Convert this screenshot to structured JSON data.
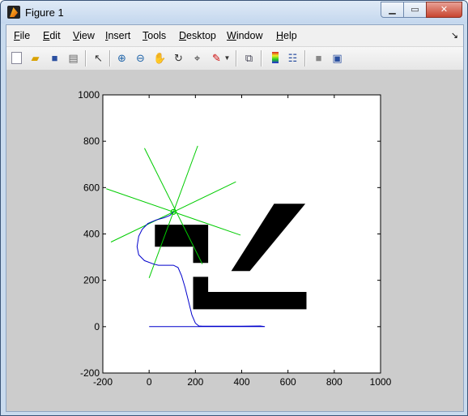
{
  "window": {
    "title": "Figure 1"
  },
  "menu": {
    "items": [
      {
        "key": "F",
        "rest": "ile"
      },
      {
        "key": "E",
        "rest": "dit"
      },
      {
        "key": "V",
        "rest": "iew"
      },
      {
        "key": "I",
        "rest": "nsert"
      },
      {
        "key": "T",
        "rest": "ools"
      },
      {
        "key": "D",
        "rest": "esktop"
      },
      {
        "key": "W",
        "rest": "indow"
      },
      {
        "key": "H",
        "rest": "elp"
      }
    ],
    "overflow_icon": "corner-arrow-icon"
  },
  "toolbar": {
    "icons": [
      "new-figure-icon",
      "open-file-icon",
      "save-icon",
      "print-icon",
      "edit-plot-arrow-icon",
      "zoom-in-icon",
      "zoom-out-icon",
      "pan-hand-icon",
      "rotate-3d-icon",
      "data-cursor-icon",
      "brush-icon",
      "brush-dropdown-icon",
      "link-plot-icon",
      "insert-colorbar-icon",
      "insert-legend-icon",
      "hide-plot-tools-icon",
      "show-plot-tools-icon"
    ]
  },
  "chart_data": {
    "type": "line",
    "xlim": [
      -200,
      1000
    ],
    "ylim": [
      -200,
      1000
    ],
    "xticks": [
      "-200",
      "0",
      "200",
      "400",
      "600",
      "800",
      "1000"
    ],
    "yticks": [
      "-200",
      "0",
      "200",
      "400",
      "600",
      "800",
      "1000"
    ],
    "grid": false,
    "colors": {
      "path": "#0000cc",
      "rays": "#00cc00",
      "obstacle": "#000000"
    },
    "obstacles": [
      [
        [
          25,
          440
        ],
        [
          255,
          440
        ],
        [
          255,
          275
        ],
        [
          190,
          275
        ],
        [
          190,
          345
        ],
        [
          25,
          345
        ]
      ],
      [
        [
          190,
          215
        ],
        [
          255,
          215
        ],
        [
          255,
          150
        ],
        [
          680,
          150
        ],
        [
          680,
          75
        ],
        [
          190,
          75
        ]
      ],
      [
        [
          540,
          530
        ],
        [
          675,
          530
        ],
        [
          435,
          240
        ],
        [
          355,
          240
        ]
      ]
    ],
    "sensor": {
      "x": 105,
      "y": 495
    },
    "rays": [
      [
        [
          -20,
          770
        ],
        [
          230,
          270
        ]
      ],
      [
        [
          210,
          780
        ],
        [
          0,
          210
        ]
      ],
      [
        [
          375,
          625
        ],
        [
          -165,
          365
        ]
      ],
      [
        [
          395,
          395
        ],
        [
          -185,
          595
        ]
      ]
    ],
    "path": [
      [
        0,
        0
      ],
      [
        150,
        0
      ],
      [
        250,
        0
      ],
      [
        350,
        0
      ],
      [
        500,
        0
      ],
      [
        480,
        3
      ],
      [
        400,
        2
      ],
      [
        300,
        2
      ],
      [
        230,
        2
      ],
      [
        215,
        3
      ],
      [
        200,
        15
      ],
      [
        185,
        50
      ],
      [
        170,
        110
      ],
      [
        155,
        170
      ],
      [
        140,
        220
      ],
      [
        125,
        255
      ],
      [
        105,
        265
      ],
      [
        85,
        265
      ],
      [
        65,
        265
      ],
      [
        40,
        265
      ],
      [
        20,
        270
      ],
      [
        -20,
        285
      ],
      [
        -45,
        310
      ],
      [
        -52,
        345
      ],
      [
        -45,
        390
      ],
      [
        -30,
        420
      ],
      [
        -5,
        445
      ],
      [
        30,
        460
      ],
      [
        65,
        470
      ],
      [
        90,
        480
      ],
      [
        105,
        495
      ]
    ]
  }
}
